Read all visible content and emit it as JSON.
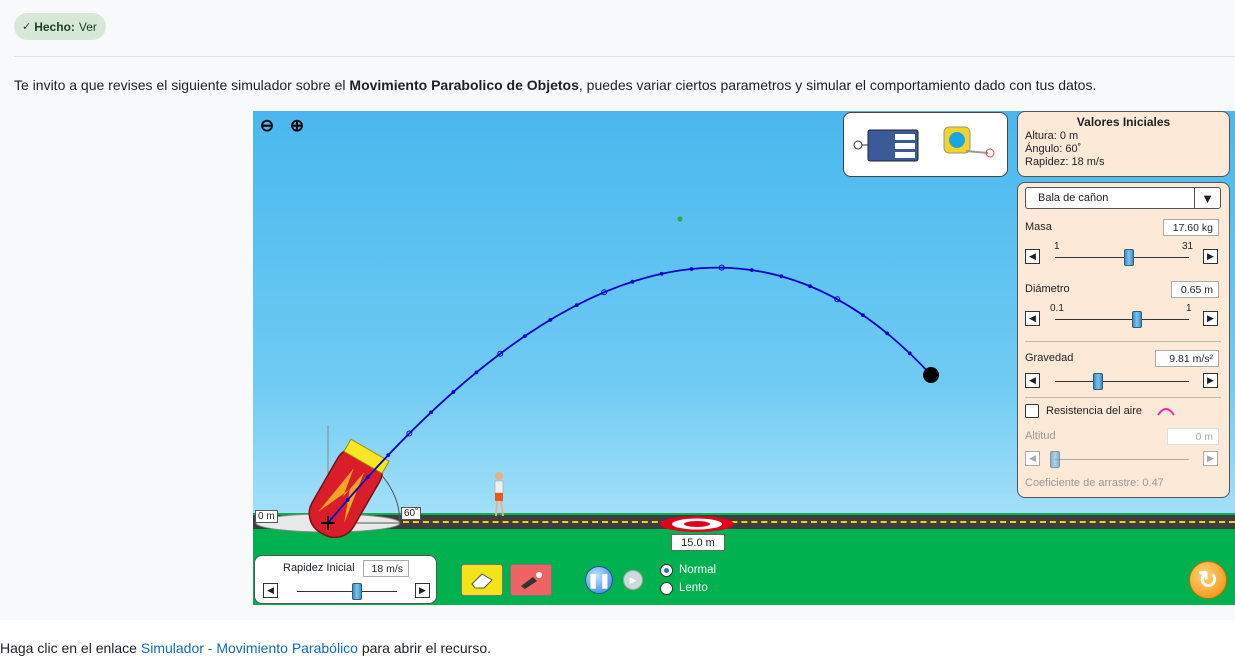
{
  "badge": {
    "status": "Hecho:",
    "action": "Ver"
  },
  "intro": {
    "before": "Te invito a que revises el siguiente simulador sobre el ",
    "bold": "Movimiento Parabolico de Objetos",
    "after": ", puedes variar ciertos parametros y simular el comportamiento dado con tus datos."
  },
  "sim": {
    "initial_values": {
      "title": "Valores Iniciales",
      "height": "Altura: 0 m",
      "angle": "Ángulo: 60˚",
      "speed": "Rapidez: 18 m/s"
    },
    "projectile_select": "Bala de cañon",
    "mass": {
      "label": "Masa",
      "value": "17.60 kg",
      "min": "1",
      "max": "31",
      "level": 0.55
    },
    "diameter": {
      "label": "Diámetro",
      "value": "0.65 m",
      "min": "0.1",
      "max": "1",
      "level": 0.61
    },
    "gravity": {
      "label": "Gravedad",
      "value": "9.81 m/s²",
      "level": 0.32
    },
    "air_resistance": {
      "label": "Resistencia del aire",
      "checked": false
    },
    "altitude": {
      "label": "Altitud",
      "value": "0 m",
      "level": 0.0
    },
    "drag": "Coeficiente de arrastre: 0.47",
    "initial_speed": {
      "label": "Rapidez Inicial",
      "value": "18 m/s",
      "level": 0.6
    },
    "target_distance": "15.0 m",
    "height_marker": "0 m",
    "angle_marker": "60˚",
    "speed_modes": {
      "normal": "Normal",
      "slow": "Lento",
      "selected": "normal"
    },
    "icons": {
      "zoom_out": "zoom-out-icon",
      "zoom_in": "zoom-in-icon",
      "eraser": "eraser-icon",
      "fire": "fire-icon",
      "pause": "pause-icon",
      "step": "step-icon",
      "reset": "reset-icon"
    }
  },
  "footer": {
    "before": "Haga clic en el enlace ",
    "link": "Simulador - Movimiento Parabólico",
    "after": " para abrir el recurso."
  },
  "colors": {
    "sky": "#49b8ee",
    "ground": "#00b14f",
    "panel": "#fde9d7",
    "trajectory": "#0000cc",
    "link": "#0f6cbf"
  }
}
